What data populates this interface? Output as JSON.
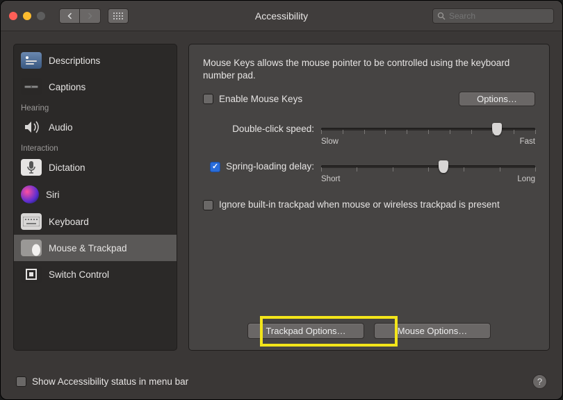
{
  "header": {
    "title": "Accessibility",
    "search_placeholder": "Search"
  },
  "sidebar": {
    "sections": {
      "hearing": "Hearing",
      "interaction": "Interaction"
    },
    "items": {
      "descriptions": "Descriptions",
      "captions": "Captions",
      "audio": "Audio",
      "dictation": "Dictation",
      "siri": "Siri",
      "keyboard": "Keyboard",
      "mouse_trackpad": "Mouse & Trackpad",
      "switch_control": "Switch Control"
    }
  },
  "main": {
    "intro": "Mouse Keys allows the mouse pointer to be controlled using the keyboard number pad.",
    "enable_mouse_keys": "Enable Mouse Keys",
    "options_btn": "Options…",
    "double_click_label": "Double-click speed:",
    "slow": "Slow",
    "fast": "Fast",
    "spring_loading_label": "Spring-loading delay:",
    "short": "Short",
    "long": "Long",
    "ignore_trackpad": "Ignore built-in trackpad when mouse or wireless trackpad is present",
    "trackpad_options_btn": "Trackpad Options…",
    "mouse_options_btn": "Mouse Options…"
  },
  "footer": {
    "show_status": "Show Accessibility status in menu bar",
    "help": "?"
  }
}
